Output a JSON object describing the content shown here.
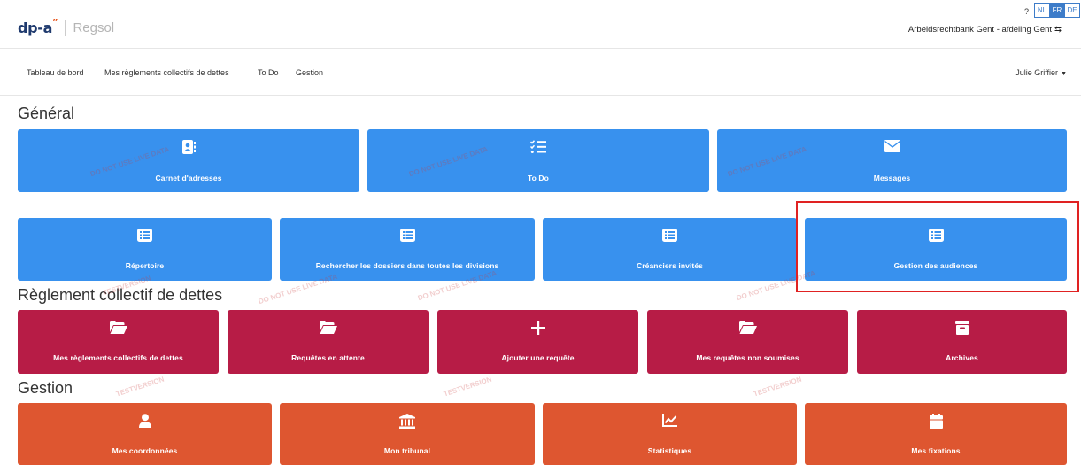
{
  "brand": {
    "name_main": "dp-a",
    "name_mark": "”",
    "name_sub": "Regsol"
  },
  "header": {
    "help": "?",
    "languages": [
      {
        "code": "NL",
        "active": false
      },
      {
        "code": "FR",
        "active": true
      },
      {
        "code": "DE",
        "active": false
      }
    ],
    "court": "Arbeidsrechtbank Gent - afdeling Gent",
    "swap_icon": "⇆"
  },
  "nav": {
    "items": [
      "Tableau de bord",
      "Mes règlements collectifs de dettes",
      "To Do",
      "Gestion"
    ],
    "user": "Julie Griffier"
  },
  "sections": {
    "general": {
      "title": "Général",
      "row1": [
        {
          "label": "Carnet d'adresses",
          "icon": "address-book-icon"
        },
        {
          "label": "To Do",
          "icon": "checklist-icon"
        },
        {
          "label": "Messages",
          "icon": "envelope-icon"
        }
      ],
      "row2": [
        {
          "label": "Répertoire",
          "icon": "list-icon"
        },
        {
          "label": "Rechercher les dossiers dans toutes les divisions",
          "icon": "list-icon"
        },
        {
          "label": "Créanciers invités",
          "icon": "list-icon"
        },
        {
          "label": "Gestion des audiences",
          "icon": "list-icon"
        }
      ]
    },
    "collective": {
      "title": "Règlement collectif de dettes",
      "tiles": [
        {
          "label": "Mes règlements collectifs de dettes",
          "icon": "folder-open-icon"
        },
        {
          "label": "Requêtes en attente",
          "icon": "folder-open-icon"
        },
        {
          "label": "Ajouter une requête",
          "icon": "plus-icon"
        },
        {
          "label": "Mes requêtes non soumises",
          "icon": "folder-open-icon"
        },
        {
          "label": "Archives",
          "icon": "archive-icon"
        }
      ]
    },
    "management": {
      "title": "Gestion",
      "tiles": [
        {
          "label": "Mes coordonnées",
          "icon": "user-icon"
        },
        {
          "label": "Mon tribunal",
          "icon": "courthouse-icon"
        },
        {
          "label": "Statistiques",
          "icon": "chart-line-icon"
        },
        {
          "label": "Mes fixations",
          "icon": "calendar-icon"
        }
      ]
    }
  },
  "watermarks": {
    "line1": "TESTVERSION",
    "line2": "DO NOT USE LIVE DATA"
  },
  "colors": {
    "blue": "#3891ee",
    "red": "#b71c46",
    "orange": "#de5630",
    "highlight": "#e02222"
  }
}
